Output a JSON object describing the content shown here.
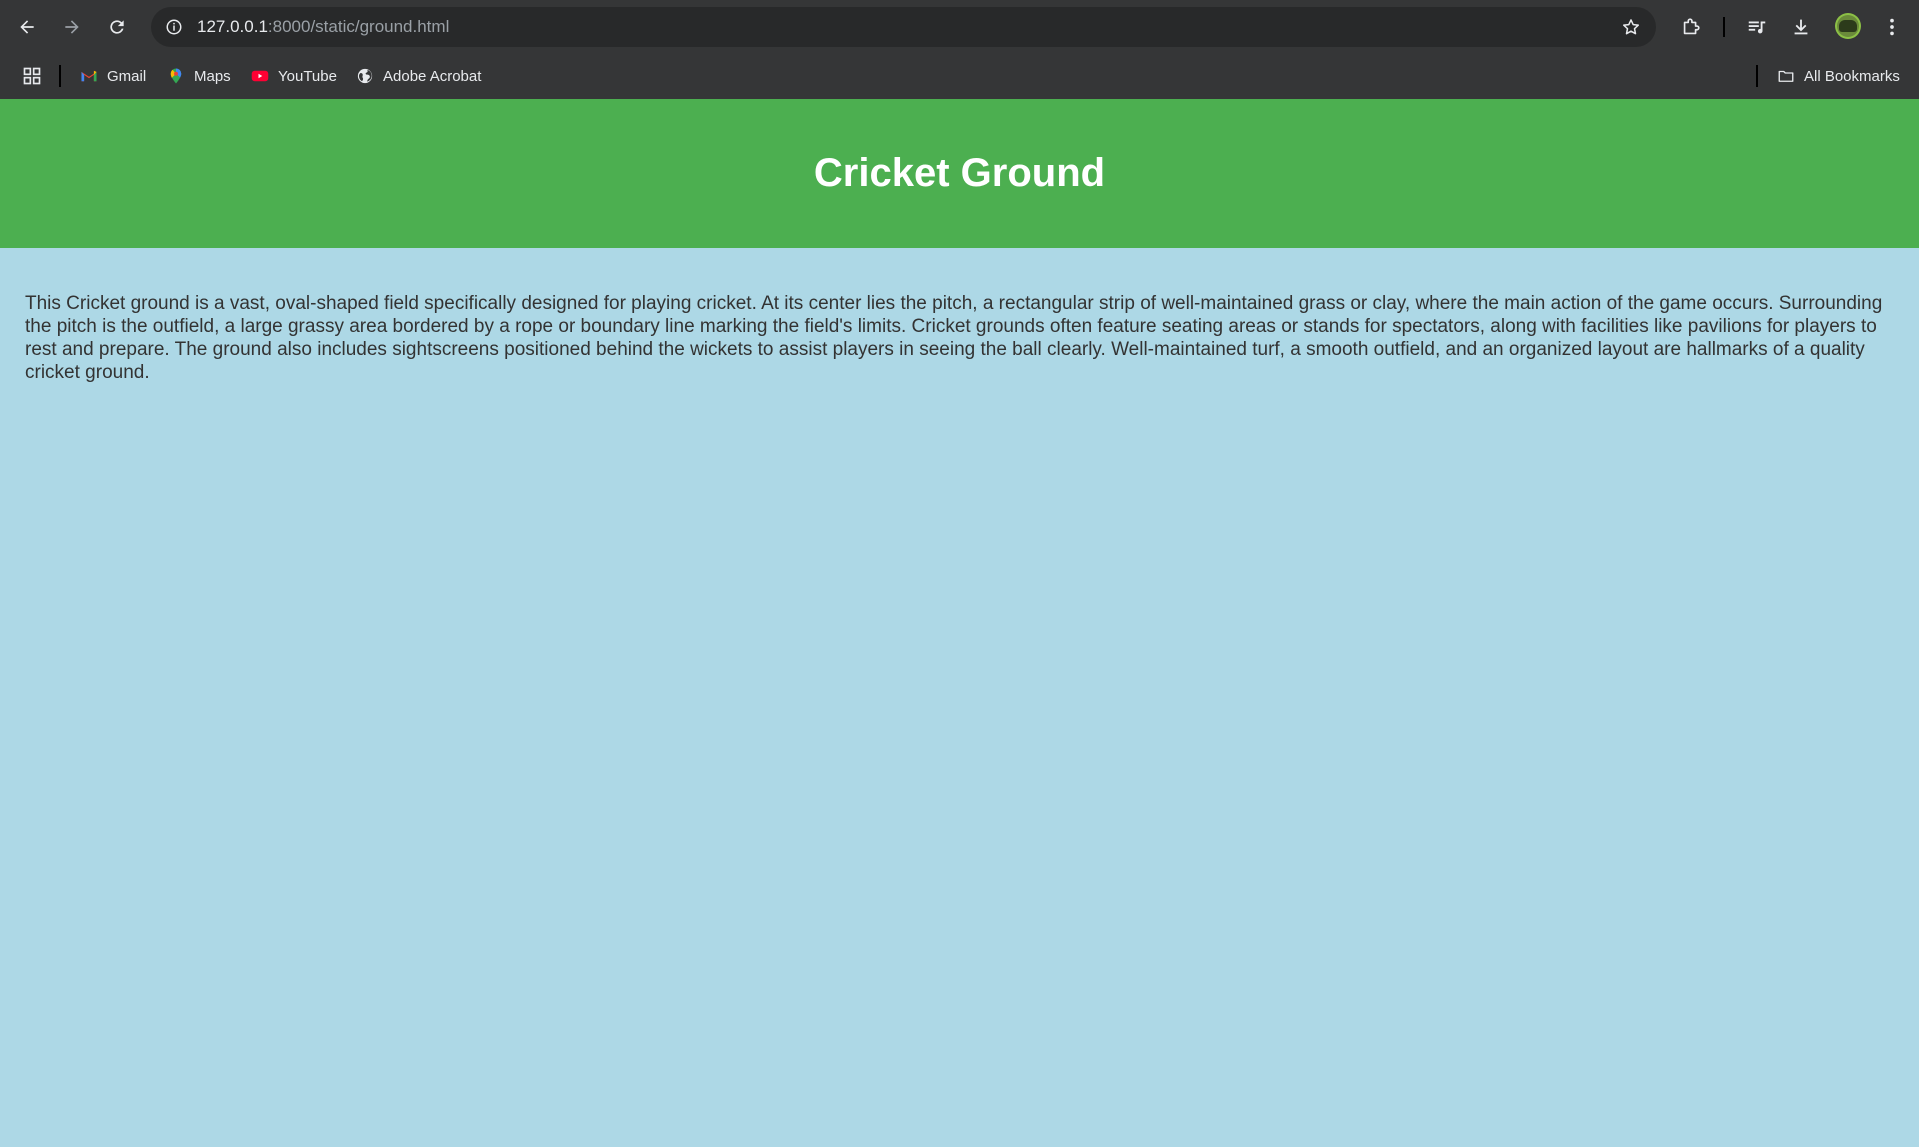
{
  "browser": {
    "url_host": "127.0.0.1",
    "url_path": ":8000/static/ground.html",
    "bookmarks": [
      {
        "label": "Gmail",
        "icon": "gmail-icon"
      },
      {
        "label": "Maps",
        "icon": "maps-icon"
      },
      {
        "label": "YouTube",
        "icon": "youtube-icon"
      },
      {
        "label": "Adobe Acrobat",
        "icon": "globe-icon"
      }
    ],
    "all_bookmarks_label": "All Bookmarks"
  },
  "page": {
    "title": "Cricket Ground",
    "description": "This Cricket ground is a vast, oval-shaped field specifically designed for playing cricket. At its center lies the pitch, a rectangular strip of well-maintained grass or clay, where the main action of the game occurs. Surrounding the pitch is the outfield, a large grassy area bordered by a rope or boundary line marking the field's limits. Cricket grounds often feature seating areas or stands for spectators, along with facilities like pavilions for players to rest and prepare. The ground also includes sightscreens positioned behind the wickets to assist players in seeing the ball clearly. Well-maintained turf, a smooth outfield, and an organized layout are hallmarks of a quality cricket ground."
  },
  "colors": {
    "header_bg": "#4caf50",
    "page_bg": "#add8e6",
    "title_text": "#ffffff",
    "body_text": "#333333",
    "chrome_bg": "#353637"
  }
}
